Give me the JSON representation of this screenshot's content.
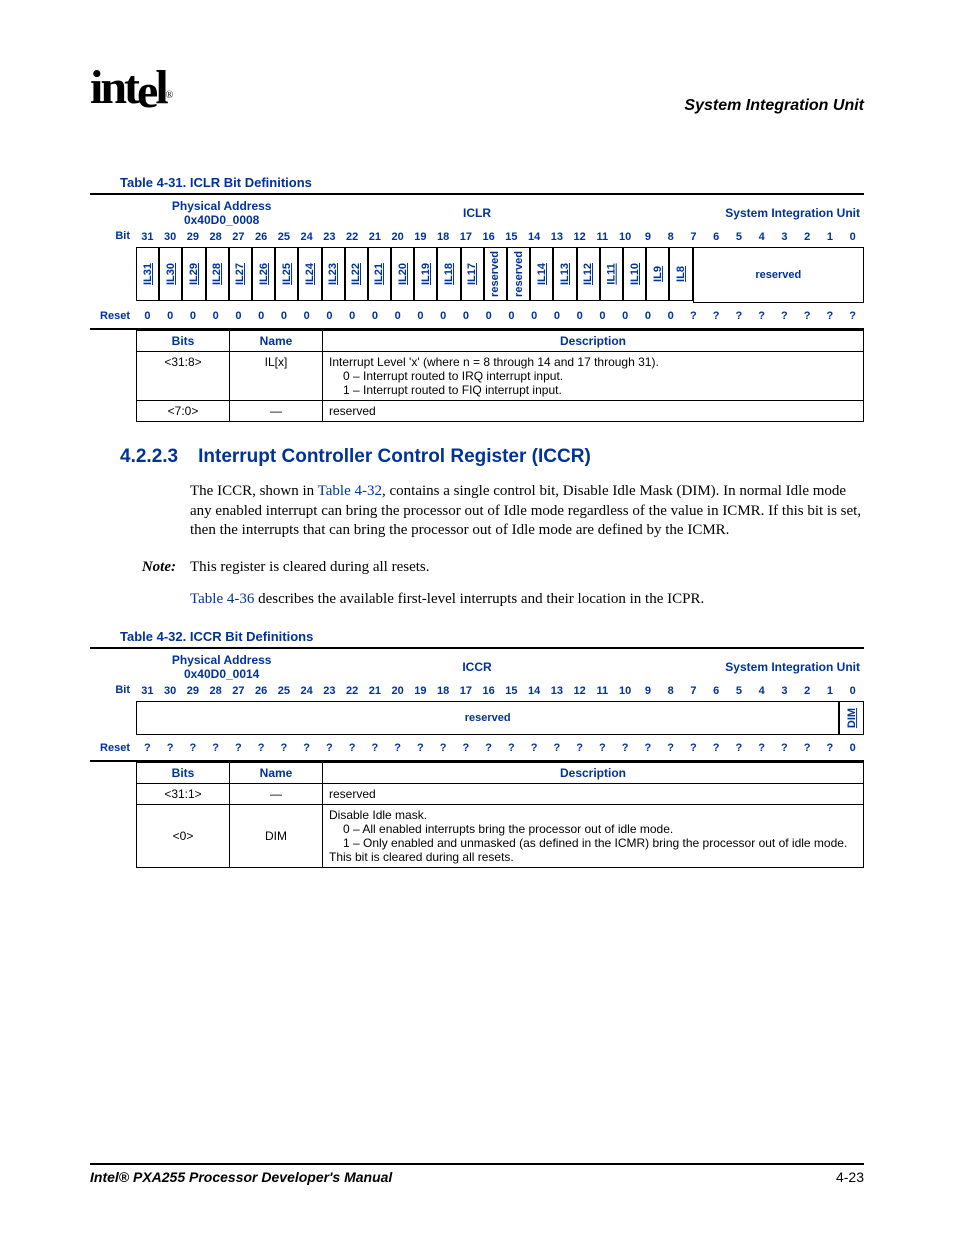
{
  "header": {
    "chapter_title": "System Integration Unit"
  },
  "footer": {
    "doc_title": "Intel® PXA255 Processor Developer's Manual",
    "page_num": "4-23"
  },
  "table31": {
    "caption": "Table 4-31. ICLR Bit Definitions",
    "phys_label": "Physical Address",
    "phys_addr": "0x40D0_0008",
    "regname": "ICLR",
    "unitname": "System Integration Unit",
    "bit_label": "Bit",
    "reset_label": "Reset",
    "bits": [
      "31",
      "30",
      "29",
      "28",
      "27",
      "26",
      "25",
      "24",
      "23",
      "22",
      "21",
      "20",
      "19",
      "18",
      "17",
      "16",
      "15",
      "14",
      "13",
      "12",
      "11",
      "10",
      "9",
      "8",
      "7",
      "6",
      "5",
      "4",
      "3",
      "2",
      "1",
      "0"
    ],
    "names": [
      "IL31",
      "IL30",
      "IL29",
      "IL28",
      "IL27",
      "IL26",
      "IL25",
      "IL24",
      "IL23",
      "IL22",
      "IL21",
      "IL20",
      "IL19",
      "IL18",
      "IL17",
      "reserved",
      "reserved",
      "IL14",
      "IL13",
      "IL12",
      "IL11",
      "IL10",
      "IL9",
      "IL8"
    ],
    "reserved_tail": "reserved",
    "resets": [
      "0",
      "0",
      "0",
      "0",
      "0",
      "0",
      "0",
      "0",
      "0",
      "0",
      "0",
      "0",
      "0",
      "0",
      "0",
      "0",
      "0",
      "0",
      "0",
      "0",
      "0",
      "0",
      "0",
      "0",
      "?",
      "?",
      "?",
      "?",
      "?",
      "?",
      "?",
      "?"
    ],
    "cols": {
      "bits": "Bits",
      "name": "Name",
      "desc": "Description"
    },
    "rows": [
      {
        "bits": "<31:8>",
        "name": "IL[x]",
        "desc_line1": "Interrupt Level 'x' (where n = 8 through 14 and 17 through 31).",
        "desc_line2": "0 – Interrupt routed to IRQ interrupt input.",
        "desc_line3": "1 – Interrupt routed to FIQ interrupt input."
      },
      {
        "bits": "<7:0>",
        "name": "—",
        "desc": "reserved"
      }
    ]
  },
  "section": {
    "num": "4.2.2.3",
    "title": "Interrupt Controller Control Register (ICCR)",
    "para1a": "The ICCR, shown in ",
    "para1_link": "Table 4-32",
    "para1b": ", contains a single control bit, Disable Idle Mask (DIM). In normal Idle mode any enabled interrupt can bring the processor out of Idle mode regardless of the value in ICMR. If this bit is set, then the interrupts that can bring the processor out of Idle mode are defined by the ICMR.",
    "note_label": "Note:",
    "note_text": "This register is cleared during all resets.",
    "para2_link": "Table 4-36",
    "para2b": " describes the available first-level interrupts and their location in the ICPR."
  },
  "table32": {
    "caption": "Table 4-32. ICCR Bit Definitions",
    "phys_label": "Physical Address",
    "phys_addr": "0x40D0_0014",
    "regname": "ICCR",
    "unitname": "System Integration Unit",
    "bit_label": "Bit",
    "reset_label": "Reset",
    "bits": [
      "31",
      "30",
      "29",
      "28",
      "27",
      "26",
      "25",
      "24",
      "23",
      "22",
      "21",
      "20",
      "19",
      "18",
      "17",
      "16",
      "15",
      "14",
      "13",
      "12",
      "11",
      "10",
      "9",
      "8",
      "7",
      "6",
      "5",
      "4",
      "3",
      "2",
      "1",
      "0"
    ],
    "reserved_label": "reserved",
    "dim_label": "DIM",
    "resets": [
      "?",
      "?",
      "?",
      "?",
      "?",
      "?",
      "?",
      "?",
      "?",
      "?",
      "?",
      "?",
      "?",
      "?",
      "?",
      "?",
      "?",
      "?",
      "?",
      "?",
      "?",
      "?",
      "?",
      "?",
      "?",
      "?",
      "?",
      "?",
      "?",
      "?",
      "?",
      "0"
    ],
    "cols": {
      "bits": "Bits",
      "name": "Name",
      "desc": "Description"
    },
    "rows": [
      {
        "bits": "<31:1>",
        "name": "—",
        "desc": "reserved"
      },
      {
        "bits": "<0>",
        "name": "DIM",
        "d1": "Disable Idle mask.",
        "d2": "0 – All enabled interrupts bring the processor out of idle mode.",
        "d3": "1 – Only enabled and unmasked (as defined in the ICMR) bring the processor out of idle mode.",
        "d4": "This bit is cleared during all resets."
      }
    ]
  },
  "chart_data": {
    "type": "table",
    "registers": [
      {
        "name": "ICLR",
        "address": "0x40D0_0008",
        "unit": "System Integration Unit",
        "bits": {
          "31": "IL31",
          "30": "IL30",
          "29": "IL29",
          "28": "IL28",
          "27": "IL27",
          "26": "IL26",
          "25": "IL25",
          "24": "IL24",
          "23": "IL23",
          "22": "IL22",
          "21": "IL21",
          "20": "IL20",
          "19": "IL19",
          "18": "IL18",
          "17": "IL17",
          "16": "reserved",
          "15": "reserved",
          "14": "IL14",
          "13": "IL13",
          "12": "IL12",
          "11": "IL11",
          "10": "IL10",
          "9": "IL9",
          "8": "IL8",
          "7:0": "reserved"
        },
        "reset": {
          "31": 0,
          "30": 0,
          "29": 0,
          "28": 0,
          "27": 0,
          "26": 0,
          "25": 0,
          "24": 0,
          "23": 0,
          "22": 0,
          "21": 0,
          "20": 0,
          "19": 0,
          "18": 0,
          "17": 0,
          "16": 0,
          "15": 0,
          "14": 0,
          "13": 0,
          "12": 0,
          "11": 0,
          "10": 0,
          "9": 0,
          "8": 0,
          "7": "?",
          "6": "?",
          "5": "?",
          "4": "?",
          "3": "?",
          "2": "?",
          "1": "?",
          "0": "?"
        },
        "fields": [
          {
            "bits": "<31:8>",
            "name": "IL[x]",
            "description": "Interrupt Level 'x' (where n = 8 through 14 and 17 through 31). 0 – Interrupt routed to IRQ interrupt input. 1 – Interrupt routed to FIQ interrupt input."
          },
          {
            "bits": "<7:0>",
            "name": "—",
            "description": "reserved"
          }
        ]
      },
      {
        "name": "ICCR",
        "address": "0x40D0_0014",
        "unit": "System Integration Unit",
        "bits": {
          "31:1": "reserved",
          "0": "DIM"
        },
        "reset": {
          "31": "?",
          "30": "?",
          "29": "?",
          "28": "?",
          "27": "?",
          "26": "?",
          "25": "?",
          "24": "?",
          "23": "?",
          "22": "?",
          "21": "?",
          "20": "?",
          "19": "?",
          "18": "?",
          "17": "?",
          "16": "?",
          "15": "?",
          "14": "?",
          "13": "?",
          "12": "?",
          "11": "?",
          "10": "?",
          "9": "?",
          "8": "?",
          "7": "?",
          "6": "?",
          "5": "?",
          "4": "?",
          "3": "?",
          "2": "?",
          "1": "?",
          "0": 0
        },
        "fields": [
          {
            "bits": "<31:1>",
            "name": "—",
            "description": "reserved"
          },
          {
            "bits": "<0>",
            "name": "DIM",
            "description": "Disable Idle mask. 0 – All enabled interrupts bring the processor out of idle mode. 1 – Only enabled and unmasked (as defined in the ICMR) bring the processor out of idle mode. This bit is cleared during all resets."
          }
        ]
      }
    ]
  }
}
